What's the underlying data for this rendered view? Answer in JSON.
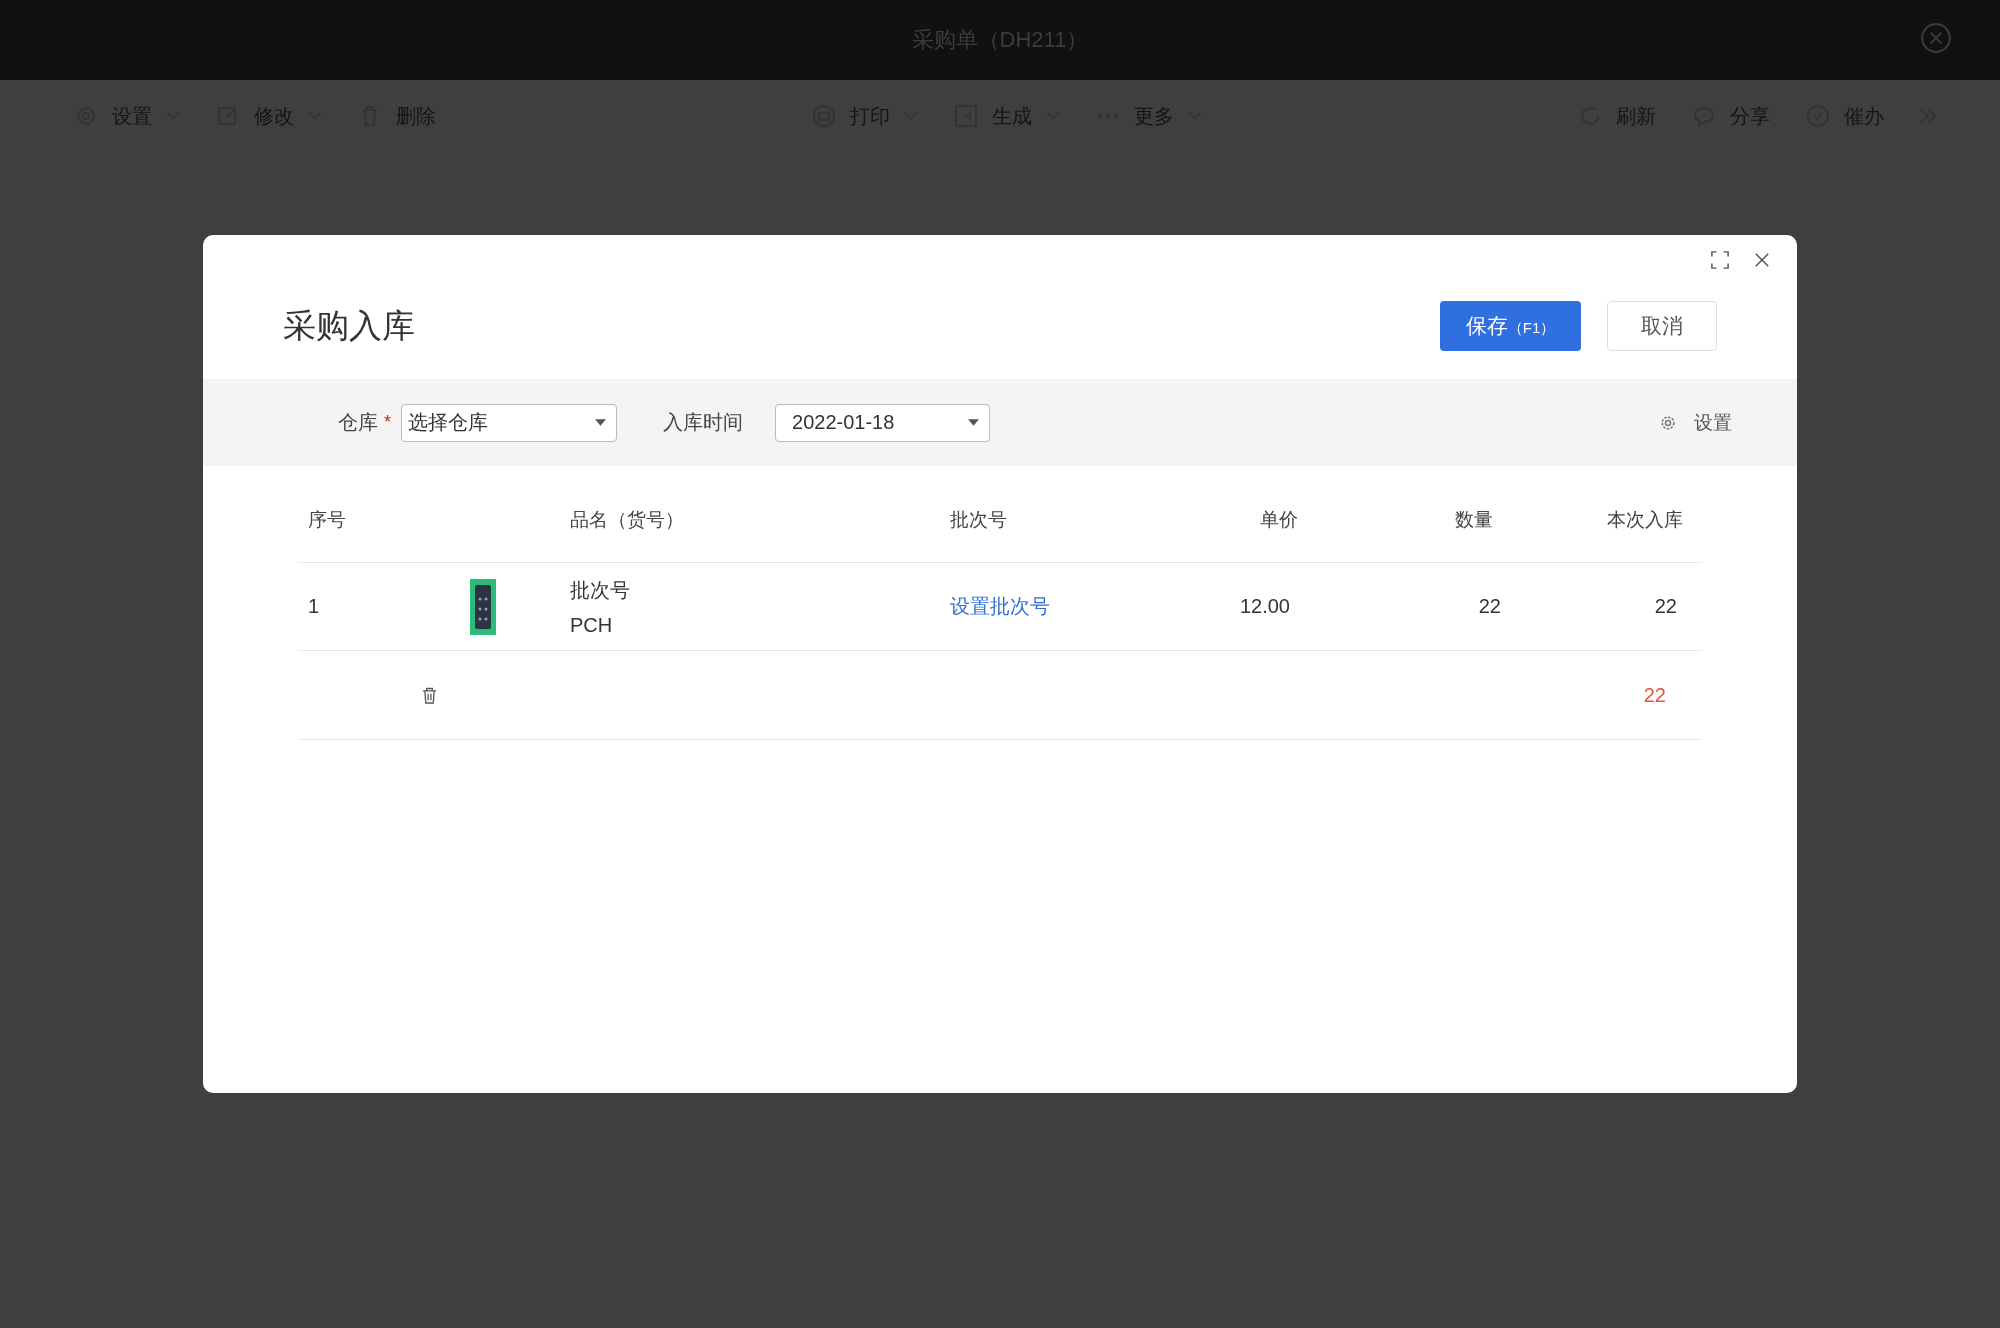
{
  "window": {
    "title": "采购单（DH211）"
  },
  "toolbar": {
    "left": [
      {
        "label": "设置",
        "kind": "settings",
        "dropdown": true
      },
      {
        "label": "修改",
        "kind": "edit",
        "dropdown": true
      },
      {
        "label": "删除",
        "kind": "delete",
        "dropdown": false
      }
    ],
    "center": [
      {
        "label": "打印",
        "kind": "print",
        "dropdown": true
      },
      {
        "label": "生成",
        "kind": "generate",
        "dropdown": true
      },
      {
        "label": "更多",
        "kind": "more",
        "dropdown": true
      }
    ],
    "right": [
      {
        "label": "刷新",
        "kind": "refresh",
        "dropdown": false
      },
      {
        "label": "分享",
        "kind": "share",
        "dropdown": false
      },
      {
        "label": "催办",
        "kind": "remind",
        "dropdown": false
      }
    ]
  },
  "dialog": {
    "title": "采购入库",
    "buttons": [
      {
        "label": "保存",
        "shortcut": "（F1）",
        "kind": "primary"
      },
      {
        "label": "取消",
        "kind": "secondary"
      }
    ],
    "filters": {
      "warehouse": {
        "label": "仓库",
        "required_mark": "*",
        "placeholder": "选择仓库"
      },
      "date": {
        "label": "入库时间",
        "value": "2022-01-18"
      },
      "settings_label": "设置"
    },
    "table": {
      "columns": [
        "序号",
        "品名（货号）",
        "批次号",
        "单价",
        "数量",
        "本次入库"
      ],
      "rows": [
        {
          "index": "1",
          "name": "批次号",
          "code": "PCH",
          "batch_link": "设置批次号",
          "price": "12.00",
          "quantity": "22",
          "inbound": "22"
        }
      ],
      "total": "22"
    }
  }
}
